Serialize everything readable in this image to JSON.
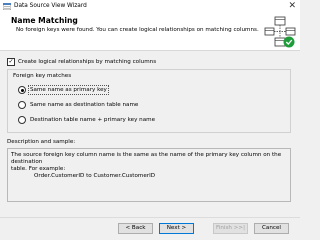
{
  "window": {
    "title": "Data Source View Wizard"
  },
  "header": {
    "title": "Name Matching",
    "description": "No foreign keys were found. You can create logical relationships on matching columns."
  },
  "create_relationships": {
    "label": "Create logical relationships by matching columns",
    "checked": true
  },
  "foreign_key_matches": {
    "legend": "Foreign key matches",
    "options": [
      {
        "label": "Same name as primary key",
        "selected": true
      },
      {
        "label": "Same name as destination table name",
        "selected": false
      },
      {
        "label": "Destination table name + primary key name",
        "selected": false
      }
    ]
  },
  "description": {
    "label": "Description and sample:",
    "line1": "The source foreign key column name is the same as the name of the primary key column on the destination",
    "line2": "table. For example:",
    "line3": "Order.CustomerID to Customer.CustomerID"
  },
  "buttons": {
    "back": "< Back",
    "next": "Next >",
    "finish": "Finish >>|",
    "cancel": "Cancel"
  },
  "colors": {
    "accent": "#0078d7",
    "check_green": "#1e9c3a"
  }
}
